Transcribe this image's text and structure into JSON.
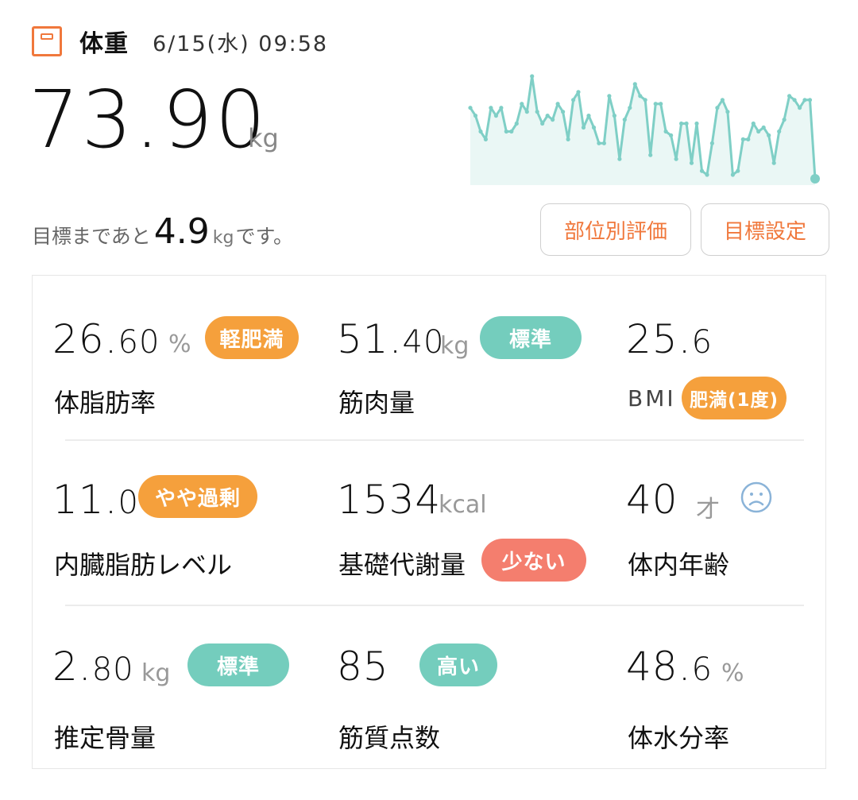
{
  "header": {
    "title": "体重",
    "datetime": "6/15(水) 09:58",
    "icon": "scale-icon"
  },
  "weight": {
    "value": "73.90",
    "unit": "kg"
  },
  "goal": {
    "prefix": "目標まであと",
    "value": "4.9",
    "unit": "kg",
    "suffix": "です。"
  },
  "buttons": {
    "parts_eval": "部位別評価",
    "goal_setting": "目標設定"
  },
  "chart_data": {
    "type": "line",
    "values": [
      64,
      62,
      58,
      56,
      64,
      62,
      64,
      58,
      58,
      60,
      65,
      63,
      72,
      63,
      60,
      62,
      61,
      65,
      63,
      56,
      66,
      68,
      59,
      62,
      59,
      55,
      55,
      67,
      62,
      51,
      61,
      64,
      70,
      67,
      66,
      52,
      65,
      65,
      58,
      57,
      51,
      60,
      60,
      50,
      60,
      48,
      47,
      55,
      64,
      66,
      63,
      47,
      48,
      56,
      56,
      60,
      58,
      59,
      57,
      50,
      58,
      61,
      67,
      66,
      64,
      66,
      66,
      46
    ],
    "color": "#7fcfc6"
  },
  "colors": {
    "accent": "#f0783c",
    "teal": "#74cdbd",
    "orange": "#f5a03c",
    "salmon": "#f47e6e"
  },
  "metrics": {
    "body_fat": {
      "int": "26.",
      "dec": "60",
      "unit": "%",
      "badge": "軽肥満",
      "label": "体脂肪率"
    },
    "muscle": {
      "int": "51.",
      "dec": "40",
      "unit": "kg",
      "badge": "標準",
      "label": "筋肉量"
    },
    "bmi": {
      "int": "25.",
      "dec": "6",
      "label": "BMI",
      "badge": "肥満(1度)"
    },
    "visceral": {
      "int": "11.",
      "dec": "0",
      "badge": "やや過剰",
      "label": "内臓脂肪レベル"
    },
    "bmr": {
      "value": "1534",
      "unit": "kcal",
      "label": "基礎代謝量",
      "badge": "少ない"
    },
    "body_age": {
      "value": "40",
      "unit": "才",
      "label": "体内年齢",
      "icon": "sad-face-icon"
    },
    "bone": {
      "int": "2.",
      "dec": "80",
      "unit": "kg",
      "badge": "標準",
      "label": "推定骨量"
    },
    "muscle_quality": {
      "value": "85",
      "badge": "高い",
      "label": "筋質点数"
    },
    "water": {
      "int": "48.",
      "dec": "6",
      "unit": "%",
      "label": "体水分率"
    }
  }
}
